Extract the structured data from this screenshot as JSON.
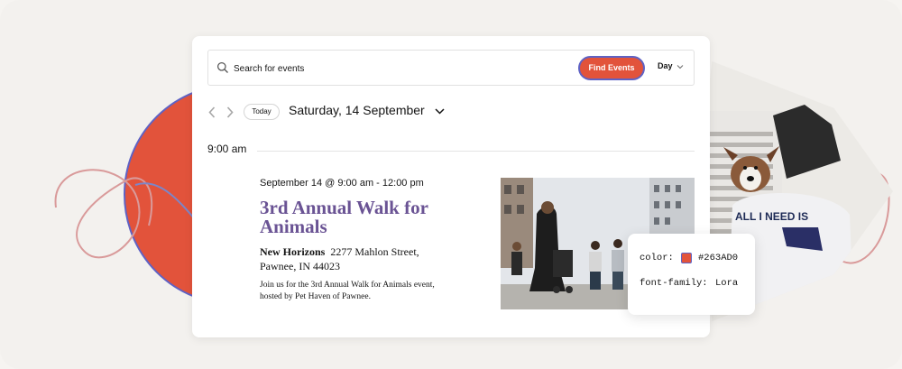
{
  "search": {
    "placeholder": "Search for events",
    "button_label": "Find Events"
  },
  "view": {
    "selected": "Day"
  },
  "nav": {
    "today_label": "Today",
    "date_title": "Saturday, 14 September"
  },
  "timeline": {
    "time_label": "9:00 am"
  },
  "event": {
    "datetime": "September 14 @ 9:00 am - 12:00 pm",
    "title": "3rd Annual Walk for Animals",
    "venue_name": "New Horizons",
    "venue_address_1": "2277 Mahlon Street,",
    "venue_address_2": "Pawnee, IN 44023",
    "description": "Join us for the 3rd Annual Walk for Animals event, hosted by Pet Haven of Pawnee."
  },
  "code_tooltip": {
    "color_label": "color:",
    "color_value": "#263AD0",
    "font_label": "font-family:",
    "font_value": "Lora"
  },
  "shirt_text": "ALL I NEED IS",
  "colors": {
    "accent": "#e2533b",
    "outline": "#5f62c4",
    "title": "#6a5394"
  },
  "icons": [
    "search-icon",
    "chevron-down-icon",
    "chevron-left-icon",
    "chevron-right-icon"
  ]
}
